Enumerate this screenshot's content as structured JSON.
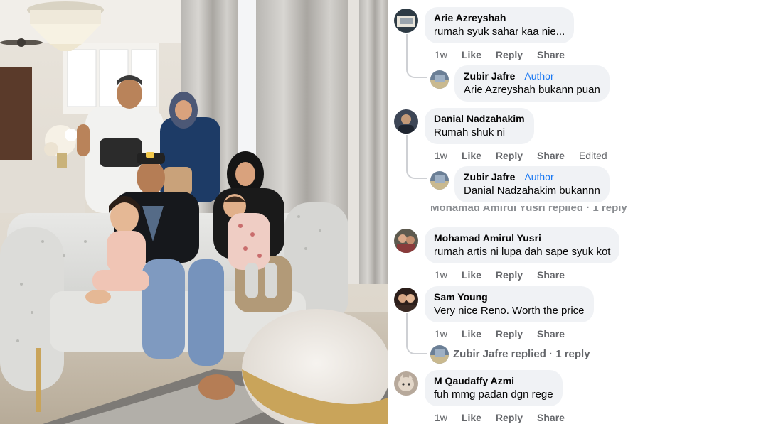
{
  "comments": [
    {
      "author": "Arie Azreyshah",
      "text": "rumah syuk sahar kaa nie...",
      "time": "1w",
      "like": "Like",
      "reply": "Reply",
      "share": "Share",
      "avatar": "avatar-arie-icon",
      "reply_item": {
        "author": "Zubir Jafre",
        "badge": "Author",
        "text": "Arie Azreyshah bukann puan",
        "avatar": "avatar-zubir-icon"
      }
    },
    {
      "author": "Danial Nadzahakim",
      "text": "Rumah shuk ni",
      "time": "1w",
      "like": "Like",
      "reply": "Reply",
      "share": "Share",
      "edited": "Edited",
      "avatar": "avatar-danial-icon",
      "reply_item": {
        "author": "Zubir Jafre",
        "badge": "Author",
        "text": "Danial Nadzahakim bukannn",
        "avatar": "avatar-zubir-icon"
      },
      "more_replies": "Mohamad Amirul Yusri replied · 1 reply"
    },
    {
      "author": "Mohamad Amirul Yusri",
      "text": "rumah artis ni lupa dah sape syuk kot",
      "time": "1w",
      "like": "Like",
      "reply": "Reply",
      "share": "Share",
      "avatar": "avatar-mohamad-icon"
    },
    {
      "author": "Sam Young",
      "text": "Very nice Reno. Worth the price",
      "time": "1w",
      "like": "Like",
      "reply": "Reply",
      "share": "Share",
      "avatar": "avatar-sam-icon",
      "replies_summary": "Zubir Jafre replied · 1 reply"
    },
    {
      "author": "M Qaudaffy Azmi",
      "text": "fuh mmg padan dgn rege",
      "time": "1w",
      "like": "Like",
      "reply": "Reply",
      "share": "Share",
      "avatar": "avatar-qaudaffy-icon"
    }
  ],
  "colors": {
    "bubble": "#f0f2f5",
    "meta": "#65676b",
    "author_badge": "#1877f2"
  }
}
